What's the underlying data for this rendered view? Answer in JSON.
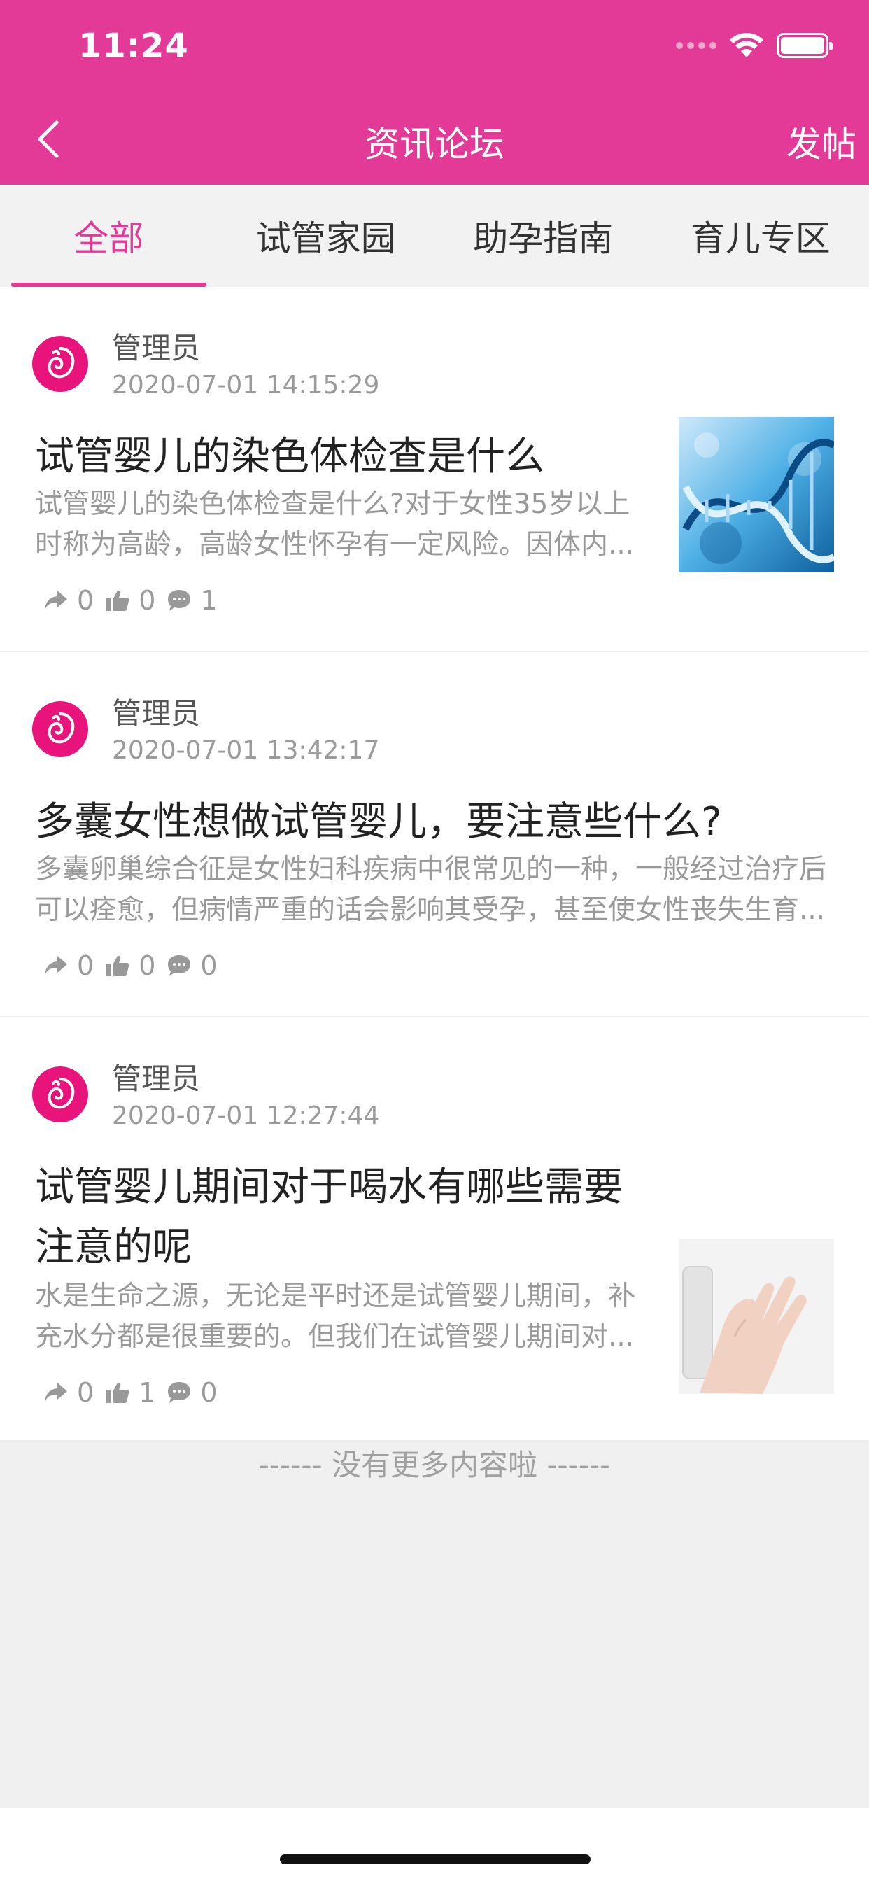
{
  "status_bar": {
    "time": "11:24"
  },
  "nav": {
    "title": "资讯论坛",
    "post_button": "发帖"
  },
  "tabs": [
    {
      "label": "全部",
      "active": true
    },
    {
      "label": "试管家园",
      "active": false
    },
    {
      "label": "助孕指南",
      "active": false
    },
    {
      "label": "育儿专区",
      "active": false
    }
  ],
  "posts": [
    {
      "author": "管理员",
      "date": "2020-07-01 14:15:29",
      "title": "试管婴儿的染色体检查是什么",
      "summary": "试管婴儿的染色体检查是什么?对于女性35岁以上时称为高龄，高龄女性怀孕有一定风险。因体内...",
      "shares": "0",
      "likes": "0",
      "comments": "1",
      "thumbnail_icon": "dna-image"
    },
    {
      "author": "管理员",
      "date": "2020-07-01 13:42:17",
      "title": "多囊女性想做试管婴儿，要注意些什么?",
      "summary": "多囊卵巢综合征是女性妇科疾病中很常见的一种，一般经过治疗后可以痊愈，但病情严重的话会影响其受孕，甚至使女性丧失生育...",
      "shares": "0",
      "likes": "0",
      "comments": "0"
    },
    {
      "author": "管理员",
      "date": "2020-07-01 12:27:44",
      "title": "试管婴儿期间对于喝水有哪些需要注意的呢",
      "summary": "水是生命之源，无论是平时还是试管婴儿期间，补充水分都是很重要的。但我们在试管婴儿期间对...",
      "shares": "0",
      "likes": "1",
      "comments": "0",
      "thumbnail_icon": "water-glass-image"
    }
  ],
  "footer": {
    "text": "------ 没有更多内容啦 ------"
  },
  "colors": {
    "primary": "#e23a96",
    "avatar": "#e8137b"
  }
}
